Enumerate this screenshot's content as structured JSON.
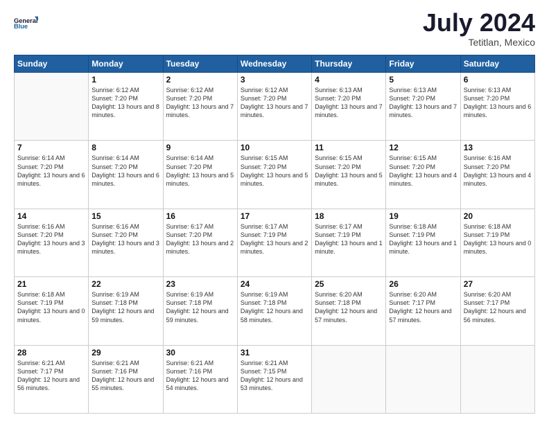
{
  "header": {
    "logo_line1": "General",
    "logo_line2": "Blue",
    "month": "July 2024",
    "location": "Tetitlan, Mexico"
  },
  "days_of_week": [
    "Sunday",
    "Monday",
    "Tuesday",
    "Wednesday",
    "Thursday",
    "Friday",
    "Saturday"
  ],
  "weeks": [
    [
      {
        "day": "",
        "sunrise": "",
        "sunset": "",
        "daylight": ""
      },
      {
        "day": "1",
        "sunrise": "Sunrise: 6:12 AM",
        "sunset": "Sunset: 7:20 PM",
        "daylight": "Daylight: 13 hours and 8 minutes."
      },
      {
        "day": "2",
        "sunrise": "Sunrise: 6:12 AM",
        "sunset": "Sunset: 7:20 PM",
        "daylight": "Daylight: 13 hours and 7 minutes."
      },
      {
        "day": "3",
        "sunrise": "Sunrise: 6:12 AM",
        "sunset": "Sunset: 7:20 PM",
        "daylight": "Daylight: 13 hours and 7 minutes."
      },
      {
        "day": "4",
        "sunrise": "Sunrise: 6:13 AM",
        "sunset": "Sunset: 7:20 PM",
        "daylight": "Daylight: 13 hours and 7 minutes."
      },
      {
        "day": "5",
        "sunrise": "Sunrise: 6:13 AM",
        "sunset": "Sunset: 7:20 PM",
        "daylight": "Daylight: 13 hours and 7 minutes."
      },
      {
        "day": "6",
        "sunrise": "Sunrise: 6:13 AM",
        "sunset": "Sunset: 7:20 PM",
        "daylight": "Daylight: 13 hours and 6 minutes."
      }
    ],
    [
      {
        "day": "7",
        "sunrise": "Sunrise: 6:14 AM",
        "sunset": "Sunset: 7:20 PM",
        "daylight": "Daylight: 13 hours and 6 minutes."
      },
      {
        "day": "8",
        "sunrise": "Sunrise: 6:14 AM",
        "sunset": "Sunset: 7:20 PM",
        "daylight": "Daylight: 13 hours and 6 minutes."
      },
      {
        "day": "9",
        "sunrise": "Sunrise: 6:14 AM",
        "sunset": "Sunset: 7:20 PM",
        "daylight": "Daylight: 13 hours and 5 minutes."
      },
      {
        "day": "10",
        "sunrise": "Sunrise: 6:15 AM",
        "sunset": "Sunset: 7:20 PM",
        "daylight": "Daylight: 13 hours and 5 minutes."
      },
      {
        "day": "11",
        "sunrise": "Sunrise: 6:15 AM",
        "sunset": "Sunset: 7:20 PM",
        "daylight": "Daylight: 13 hours and 5 minutes."
      },
      {
        "day": "12",
        "sunrise": "Sunrise: 6:15 AM",
        "sunset": "Sunset: 7:20 PM",
        "daylight": "Daylight: 13 hours and 4 minutes."
      },
      {
        "day": "13",
        "sunrise": "Sunrise: 6:16 AM",
        "sunset": "Sunset: 7:20 PM",
        "daylight": "Daylight: 13 hours and 4 minutes."
      }
    ],
    [
      {
        "day": "14",
        "sunrise": "Sunrise: 6:16 AM",
        "sunset": "Sunset: 7:20 PM",
        "daylight": "Daylight: 13 hours and 3 minutes."
      },
      {
        "day": "15",
        "sunrise": "Sunrise: 6:16 AM",
        "sunset": "Sunset: 7:20 PM",
        "daylight": "Daylight: 13 hours and 3 minutes."
      },
      {
        "day": "16",
        "sunrise": "Sunrise: 6:17 AM",
        "sunset": "Sunset: 7:20 PM",
        "daylight": "Daylight: 13 hours and 2 minutes."
      },
      {
        "day": "17",
        "sunrise": "Sunrise: 6:17 AM",
        "sunset": "Sunset: 7:19 PM",
        "daylight": "Daylight: 13 hours and 2 minutes."
      },
      {
        "day": "18",
        "sunrise": "Sunrise: 6:17 AM",
        "sunset": "Sunset: 7:19 PM",
        "daylight": "Daylight: 13 hours and 1 minute."
      },
      {
        "day": "19",
        "sunrise": "Sunrise: 6:18 AM",
        "sunset": "Sunset: 7:19 PM",
        "daylight": "Daylight: 13 hours and 1 minute."
      },
      {
        "day": "20",
        "sunrise": "Sunrise: 6:18 AM",
        "sunset": "Sunset: 7:19 PM",
        "daylight": "Daylight: 13 hours and 0 minutes."
      }
    ],
    [
      {
        "day": "21",
        "sunrise": "Sunrise: 6:18 AM",
        "sunset": "Sunset: 7:19 PM",
        "daylight": "Daylight: 13 hours and 0 minutes."
      },
      {
        "day": "22",
        "sunrise": "Sunrise: 6:19 AM",
        "sunset": "Sunset: 7:18 PM",
        "daylight": "Daylight: 12 hours and 59 minutes."
      },
      {
        "day": "23",
        "sunrise": "Sunrise: 6:19 AM",
        "sunset": "Sunset: 7:18 PM",
        "daylight": "Daylight: 12 hours and 59 minutes."
      },
      {
        "day": "24",
        "sunrise": "Sunrise: 6:19 AM",
        "sunset": "Sunset: 7:18 PM",
        "daylight": "Daylight: 12 hours and 58 minutes."
      },
      {
        "day": "25",
        "sunrise": "Sunrise: 6:20 AM",
        "sunset": "Sunset: 7:18 PM",
        "daylight": "Daylight: 12 hours and 57 minutes."
      },
      {
        "day": "26",
        "sunrise": "Sunrise: 6:20 AM",
        "sunset": "Sunset: 7:17 PM",
        "daylight": "Daylight: 12 hours and 57 minutes."
      },
      {
        "day": "27",
        "sunrise": "Sunrise: 6:20 AM",
        "sunset": "Sunset: 7:17 PM",
        "daylight": "Daylight: 12 hours and 56 minutes."
      }
    ],
    [
      {
        "day": "28",
        "sunrise": "Sunrise: 6:21 AM",
        "sunset": "Sunset: 7:17 PM",
        "daylight": "Daylight: 12 hours and 56 minutes."
      },
      {
        "day": "29",
        "sunrise": "Sunrise: 6:21 AM",
        "sunset": "Sunset: 7:16 PM",
        "daylight": "Daylight: 12 hours and 55 minutes."
      },
      {
        "day": "30",
        "sunrise": "Sunrise: 6:21 AM",
        "sunset": "Sunset: 7:16 PM",
        "daylight": "Daylight: 12 hours and 54 minutes."
      },
      {
        "day": "31",
        "sunrise": "Sunrise: 6:21 AM",
        "sunset": "Sunset: 7:15 PM",
        "daylight": "Daylight: 12 hours and 53 minutes."
      },
      {
        "day": "",
        "sunrise": "",
        "sunset": "",
        "daylight": ""
      },
      {
        "day": "",
        "sunrise": "",
        "sunset": "",
        "daylight": ""
      },
      {
        "day": "",
        "sunrise": "",
        "sunset": "",
        "daylight": ""
      }
    ]
  ]
}
